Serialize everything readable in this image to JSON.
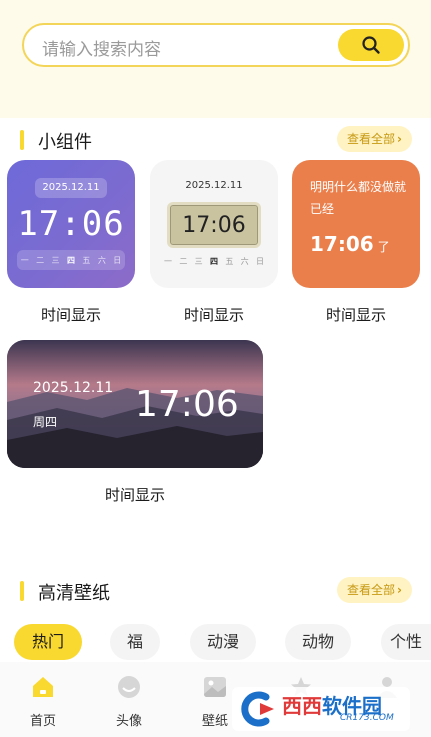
{
  "search": {
    "placeholder": "请输入搜索内容",
    "button_icon": "search-icon"
  },
  "widgets_section": {
    "title": "小组件",
    "view_all": "查看全部",
    "arrow": "›"
  },
  "widgets": [
    {
      "label": "时间显示",
      "date": "2025.12.11",
      "time": "17:06",
      "weekdays": [
        "一",
        "二",
        "三",
        "四",
        "五",
        "六",
        "日"
      ],
      "active_day": "四",
      "accent": "#6e6ad9"
    },
    {
      "label": "时间显示",
      "date": "2025.12.11",
      "time": "17:06",
      "weekdays": [
        "一",
        "二",
        "三",
        "四",
        "五",
        "六",
        "日"
      ],
      "active_day": "四",
      "accent": "#c9c3a0"
    },
    {
      "label": "时间显示",
      "message": "明明什么都没做就已经",
      "time": "17:06",
      "tail": "了",
      "accent": "#ea7f4b"
    },
    {
      "label": "时间显示",
      "date": "2025.12.11",
      "weekday": "周四",
      "time": "17:06"
    }
  ],
  "wallpaper_section": {
    "title": "高清壁纸",
    "view_all": "查看全部",
    "arrow": "›"
  },
  "categories": [
    {
      "label": "热门",
      "active": true
    },
    {
      "label": "福",
      "active": false
    },
    {
      "label": "动漫",
      "active": false
    },
    {
      "label": "动物",
      "active": false
    },
    {
      "label": "个性",
      "active": false
    }
  ],
  "nav": [
    {
      "label": "首页",
      "icon": "home-icon",
      "active": true
    },
    {
      "label": "头像",
      "icon": "avatar-icon",
      "active": false
    },
    {
      "label": "壁纸",
      "icon": "image-icon",
      "active": false
    },
    {
      "label": "",
      "icon": "star-icon",
      "active": false
    },
    {
      "label": "",
      "icon": "profile-icon",
      "active": false
    }
  ],
  "watermark": {
    "title_a": "西西",
    "title_b": "软件园",
    "url": "CR173.COM"
  },
  "colors": {
    "accent": "#f9d82f",
    "top_band": "#fffbea",
    "view_all_bg": "#fff3c4"
  }
}
